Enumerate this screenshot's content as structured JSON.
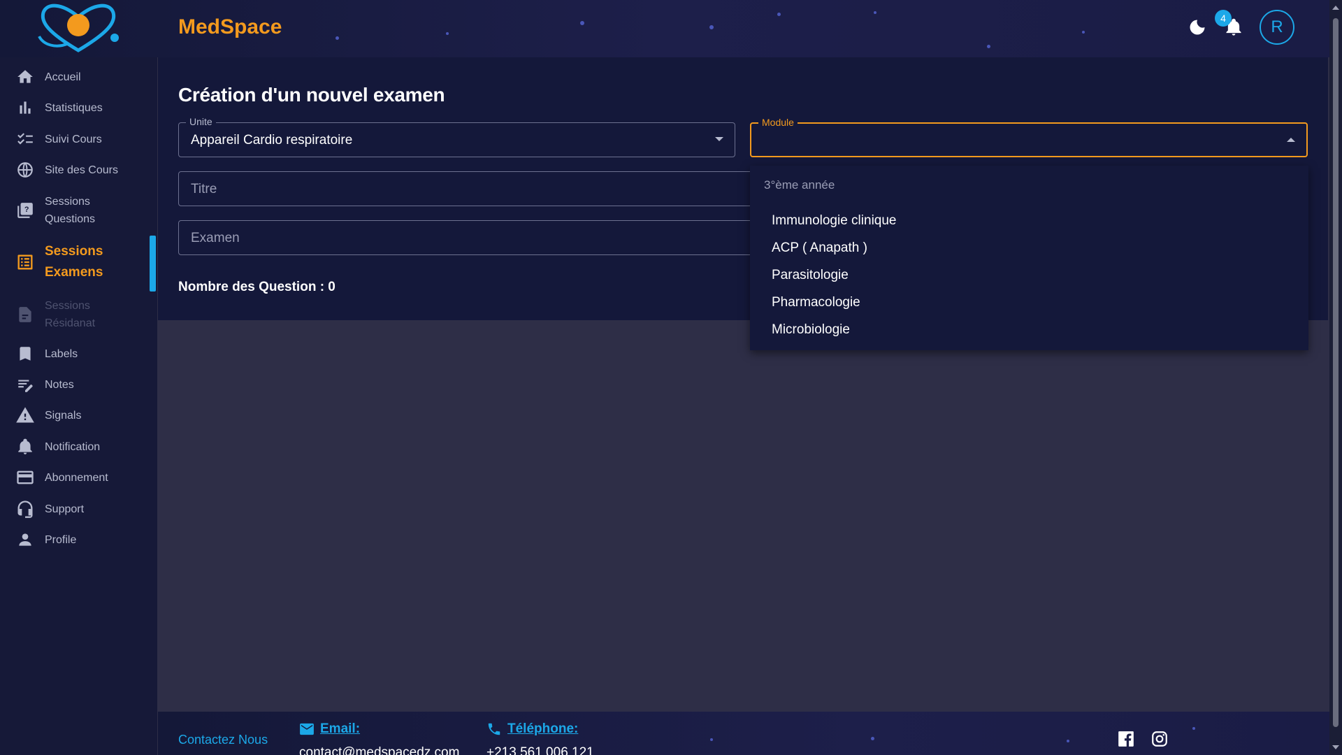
{
  "app": {
    "brand": "MedSpace"
  },
  "header": {
    "notification_count": "4",
    "avatar_initial": "R"
  },
  "sidebar": {
    "items": [
      {
        "label": "Accueil",
        "icon": "home-icon"
      },
      {
        "label": "Statistiques",
        "icon": "bar-chart-icon"
      },
      {
        "label": "Suivi Cours",
        "icon": "checklist-icon"
      },
      {
        "label": "Site des Cours",
        "icon": "globe-icon"
      },
      {
        "label": "Sessions Questions",
        "icon": "question-book-icon"
      },
      {
        "label": "Sessions Examens",
        "icon": "list-alt-icon",
        "active": true
      },
      {
        "label": "Sessions Résidanat",
        "icon": "document-icon",
        "disabled": true
      },
      {
        "label": "Labels",
        "icon": "bookmark-icon"
      },
      {
        "label": "Notes",
        "icon": "edit-notes-icon"
      },
      {
        "label": "Signals",
        "icon": "warning-icon"
      },
      {
        "label": "Notification",
        "icon": "bell-icon"
      },
      {
        "label": "Abonnement",
        "icon": "credit-card-icon"
      },
      {
        "label": "Support",
        "icon": "headset-icon"
      },
      {
        "label": "Profile",
        "icon": "person-icon"
      }
    ]
  },
  "form": {
    "title": "Création d'un nouvel examen",
    "unite": {
      "label": "Unite",
      "value": "Appareil Cardio respiratoire"
    },
    "module": {
      "label": "Module",
      "value": ""
    },
    "titre": {
      "placeholder": "Titre"
    },
    "examen": {
      "placeholder": "Examen"
    },
    "question_count": "Nombre des Question : 0"
  },
  "dropdown": {
    "group": "3°ème année",
    "options": [
      "Immunologie clinique",
      "ACP ( Anapath )",
      "Parasitologie",
      "Pharmacologie",
      "Microbiologie"
    ]
  },
  "footer": {
    "contact": "Contactez Nous",
    "email_label": "Email:",
    "email_value": "contact@medspacedz.com",
    "phone_label": "Téléphone:",
    "phone_value": "+213 561 006 121"
  },
  "colors": {
    "accent": "#f39a1e",
    "primary": "#1ca8e8",
    "sidebar_bg": "#161938",
    "card_bg": "#14183a",
    "page_bg": "#2e2e47"
  }
}
